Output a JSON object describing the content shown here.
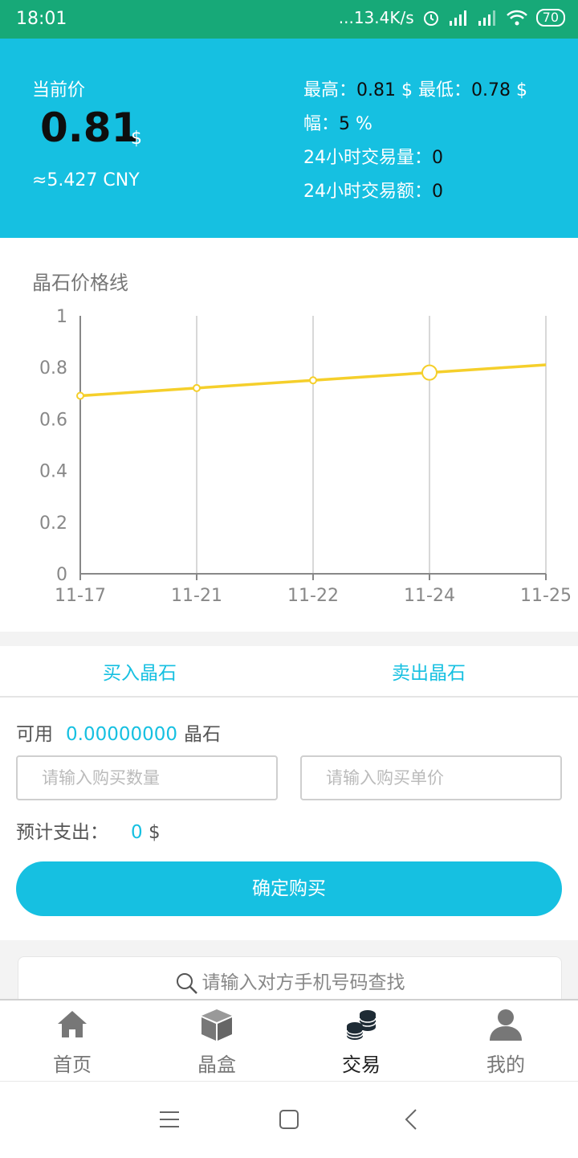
{
  "status_bar": {
    "time": "18:01",
    "network_speed": "...13.4K/s",
    "battery": "70"
  },
  "header": {
    "current_price_label": "当前价",
    "price": "0.81",
    "price_unit": "$",
    "cny": "≈5.427 CNY",
    "high_label": "最高：",
    "high_value": "0.81",
    "high_unit": "$",
    "low_label": "最低：",
    "low_value": "0.78",
    "low_unit": "$",
    "range_label": "幅：",
    "range_value": "5",
    "range_unit": "%",
    "volume_label": "24小时交易量：",
    "volume_value": "0",
    "turnover_label": "24小时交易额：",
    "turnover_value": "0"
  },
  "chart": {
    "title": "晶石价格线",
    "chart_data": {
      "type": "line",
      "x": [
        "11-17",
        "11-21",
        "11-22",
        "11-24",
        "11-25"
      ],
      "series": [
        {
          "values": [
            0.69,
            0.72,
            0.75,
            0.78,
            0.81
          ]
        }
      ],
      "ylim": [
        0,
        1
      ],
      "yticks": [
        "0",
        "0.2",
        "0.4",
        "0.6",
        "0.8",
        "1"
      ],
      "grid": "vertical",
      "highlight_index": 3,
      "line_color": "#f5cf2b"
    }
  },
  "trade": {
    "tab_buy": "买入晶石",
    "tab_sell": "卖出晶石",
    "available_label": "可用",
    "available_value": "0.00000000",
    "available_unit": "晶石",
    "qty_placeholder": "请输入购买数量",
    "price_placeholder": "请输入购买单价",
    "estimated_label": "预计支出：",
    "estimated_value": "0",
    "estimated_unit": "$",
    "confirm_label": "确定购买"
  },
  "search": {
    "placeholder": "请输入对方手机号码查找"
  },
  "tabbar": {
    "items": [
      {
        "label": "首页"
      },
      {
        "label": "晶盒"
      },
      {
        "label": "交易"
      },
      {
        "label": "我的"
      }
    ]
  },
  "colors": {
    "accent": "#16c0e1",
    "status_bar": "#17a978",
    "line": "#f5cf2b"
  }
}
